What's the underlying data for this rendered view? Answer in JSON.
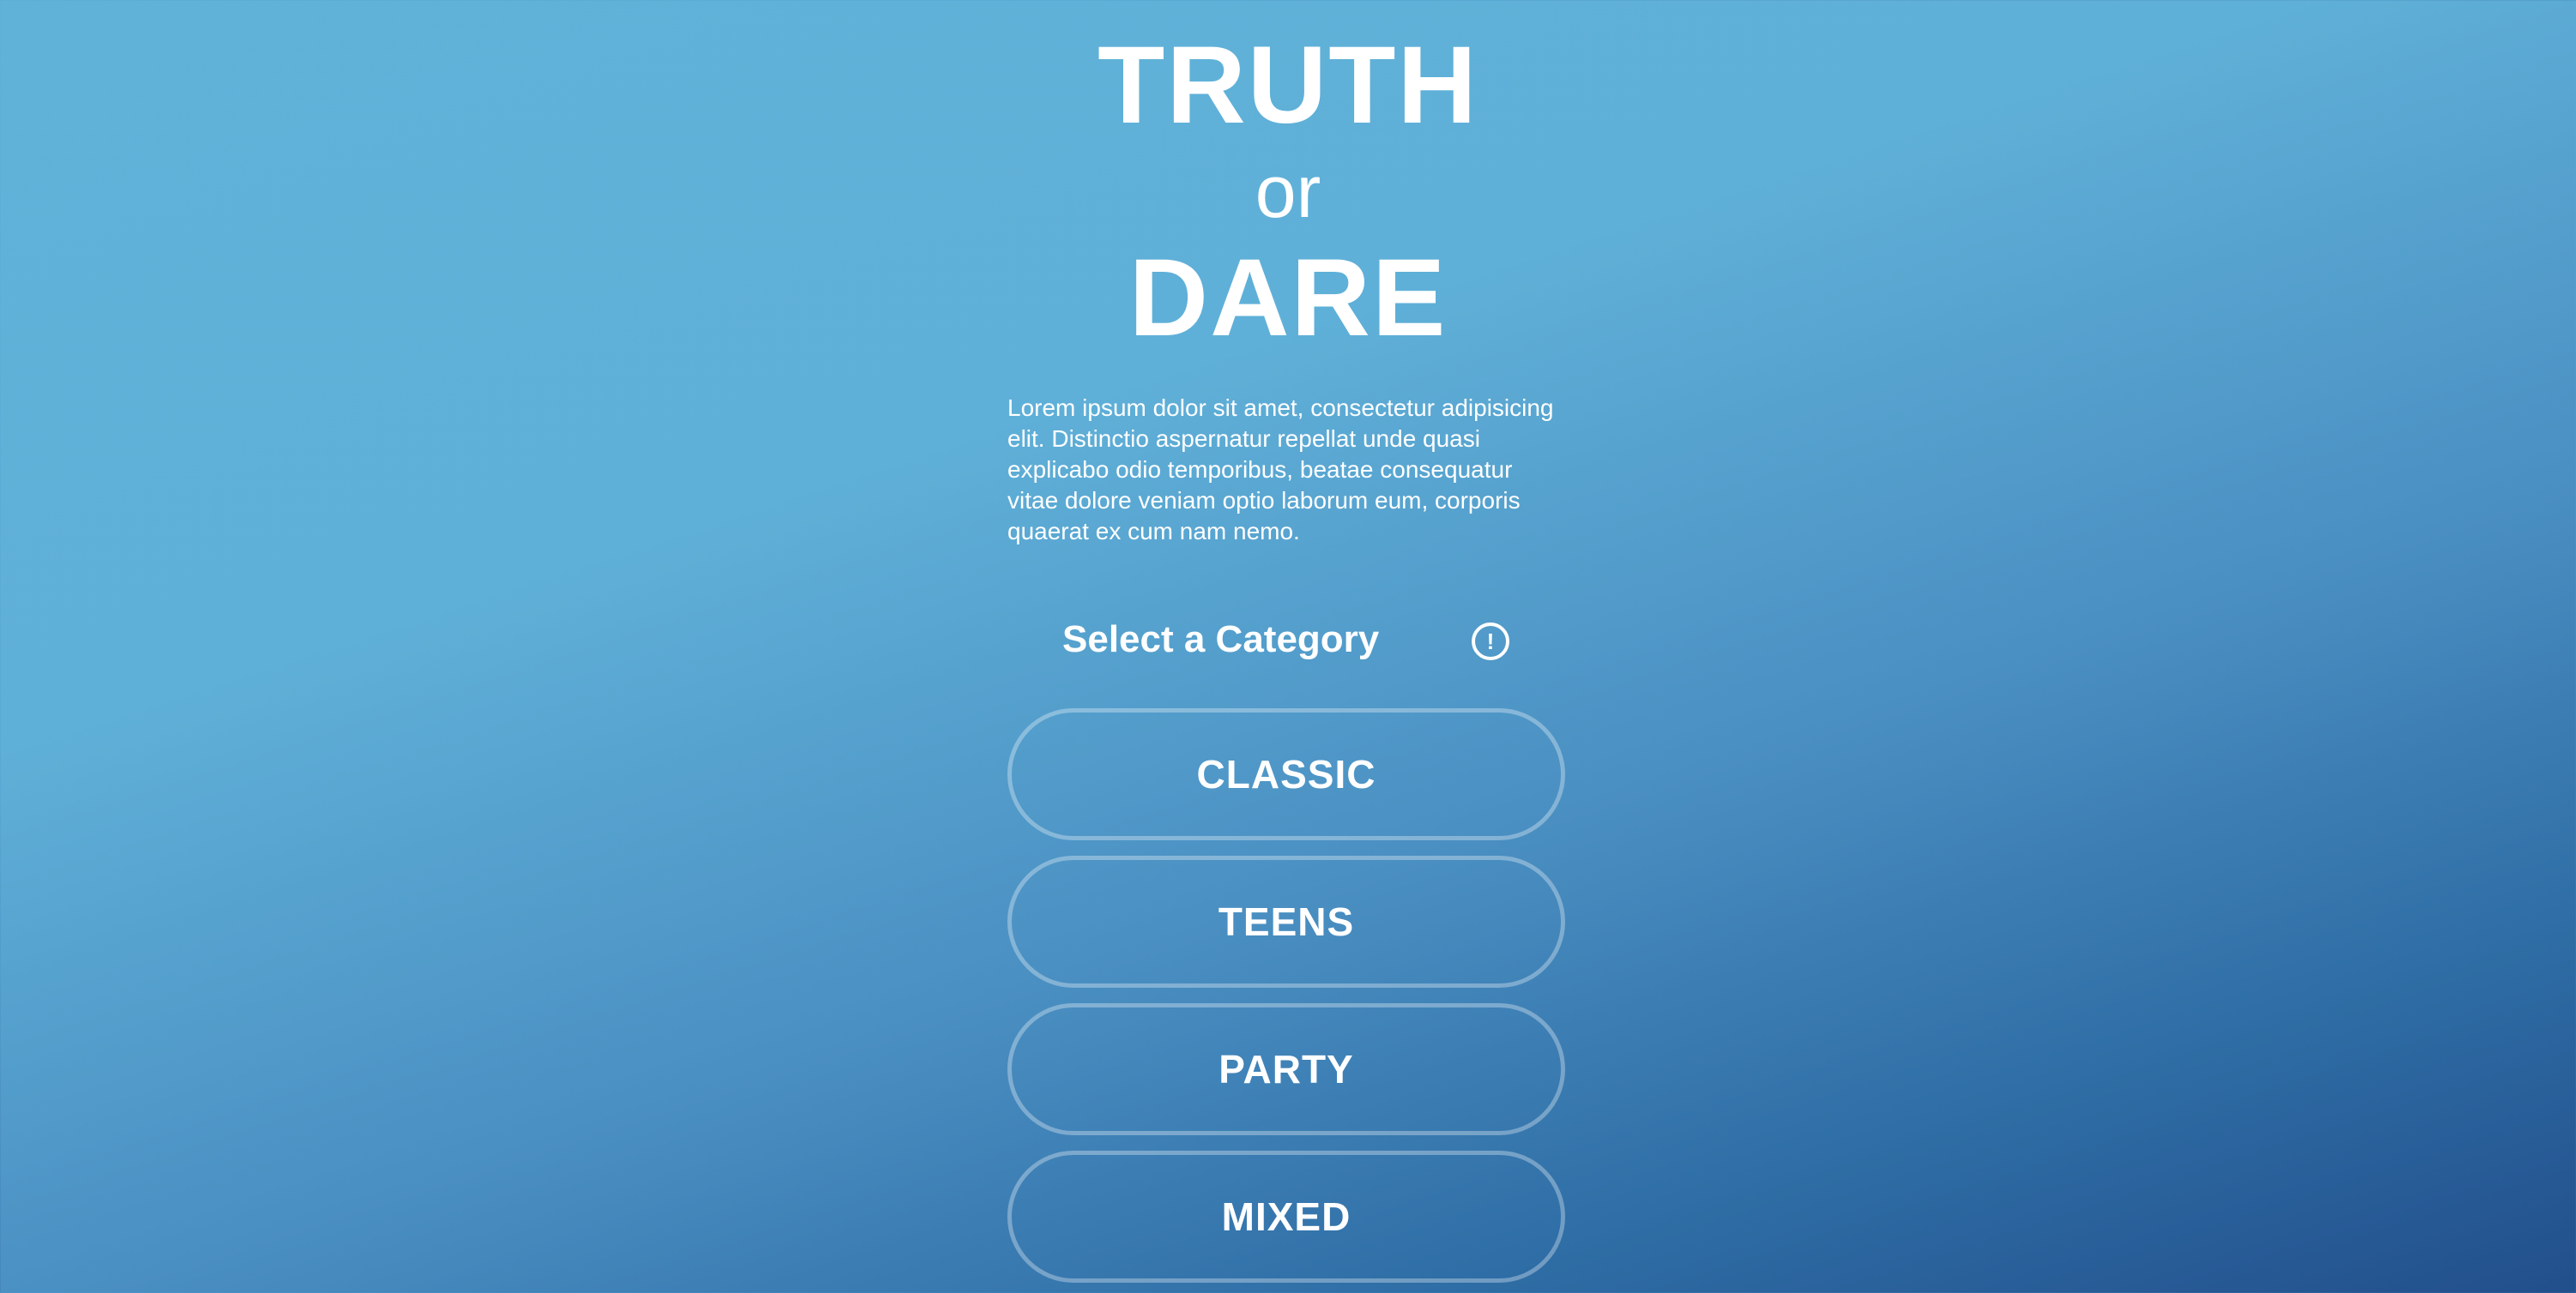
{
  "header": {
    "title_line1": "TRUTH",
    "title_line2": "or",
    "title_line3": "DARE"
  },
  "intro": {
    "text": "Lorem ipsum dolor sit amet, consectetur adipisicing elit. Distinctio aspernatur repellat unde quasi explicabo odio temporibus, beatae consequatur vitae dolore veniam optio laborum eum, corporis quaerat ex cum nam nemo."
  },
  "category_section": {
    "title": "Select a Category",
    "info_icon": "info-circle-icon",
    "info_glyph": "!"
  },
  "categories": [
    {
      "label": "CLASSIC"
    },
    {
      "label": "TEENS"
    },
    {
      "label": "PARTY"
    },
    {
      "label": "MIXED"
    }
  ],
  "colors": {
    "text": "#ffffff",
    "gradient_top": "#60b2d9",
    "gradient_bottom": "#224f8c",
    "button_border": "rgba(255,255,255,0.32)"
  }
}
